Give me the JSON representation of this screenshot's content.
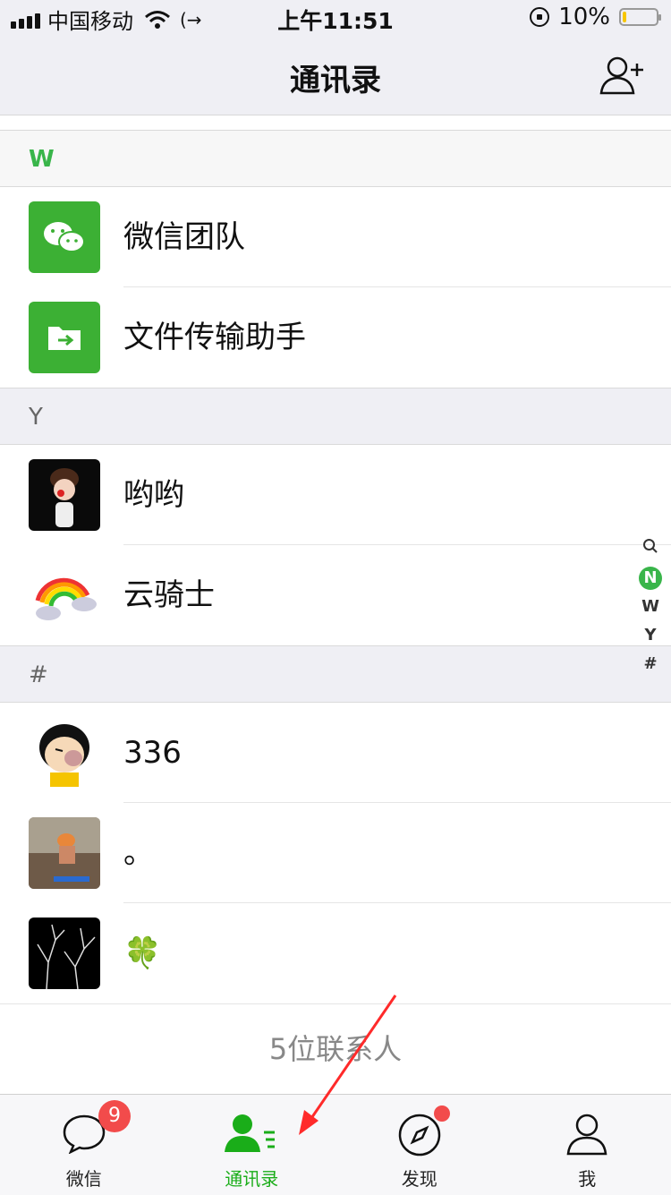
{
  "status_bar": {
    "carrier": "中国移动",
    "time": "上午11:51",
    "battery": "10%",
    "battery_level": 0.1
  },
  "nav": {
    "title": "通讯录",
    "add_icon": "add-contact-icon"
  },
  "sections": [
    {
      "letter": "W",
      "contacts": [
        {
          "name": "微信团队",
          "avatar": "wechat-team-avatar"
        },
        {
          "name": "文件传输助手",
          "avatar": "file-transfer-avatar"
        }
      ]
    },
    {
      "letter": "Y",
      "contacts": [
        {
          "name": "哟哟",
          "avatar": "youyou-avatar"
        },
        {
          "name": "云骑士",
          "avatar": "yunqishi-avatar"
        }
      ]
    },
    {
      "letter": "#",
      "contacts": [
        {
          "name": "336",
          "avatar": "336-avatar"
        },
        {
          "name": "。",
          "avatar": "dot-avatar"
        },
        {
          "name": "🍀",
          "avatar": "clover-avatar"
        }
      ]
    }
  ],
  "contact_count": "5位联系人",
  "index_bar": [
    "N",
    "W",
    "Y",
    "#"
  ],
  "tab_bar": {
    "tabs": [
      {
        "label": "微信",
        "badge": "9"
      },
      {
        "label": "通讯录"
      },
      {
        "label": "发现"
      },
      {
        "label": "我"
      }
    ]
  },
  "colors": {
    "accent": "#1aad19",
    "badge": "#f24b4b",
    "annotation_arrow": "#ff2a2a"
  }
}
